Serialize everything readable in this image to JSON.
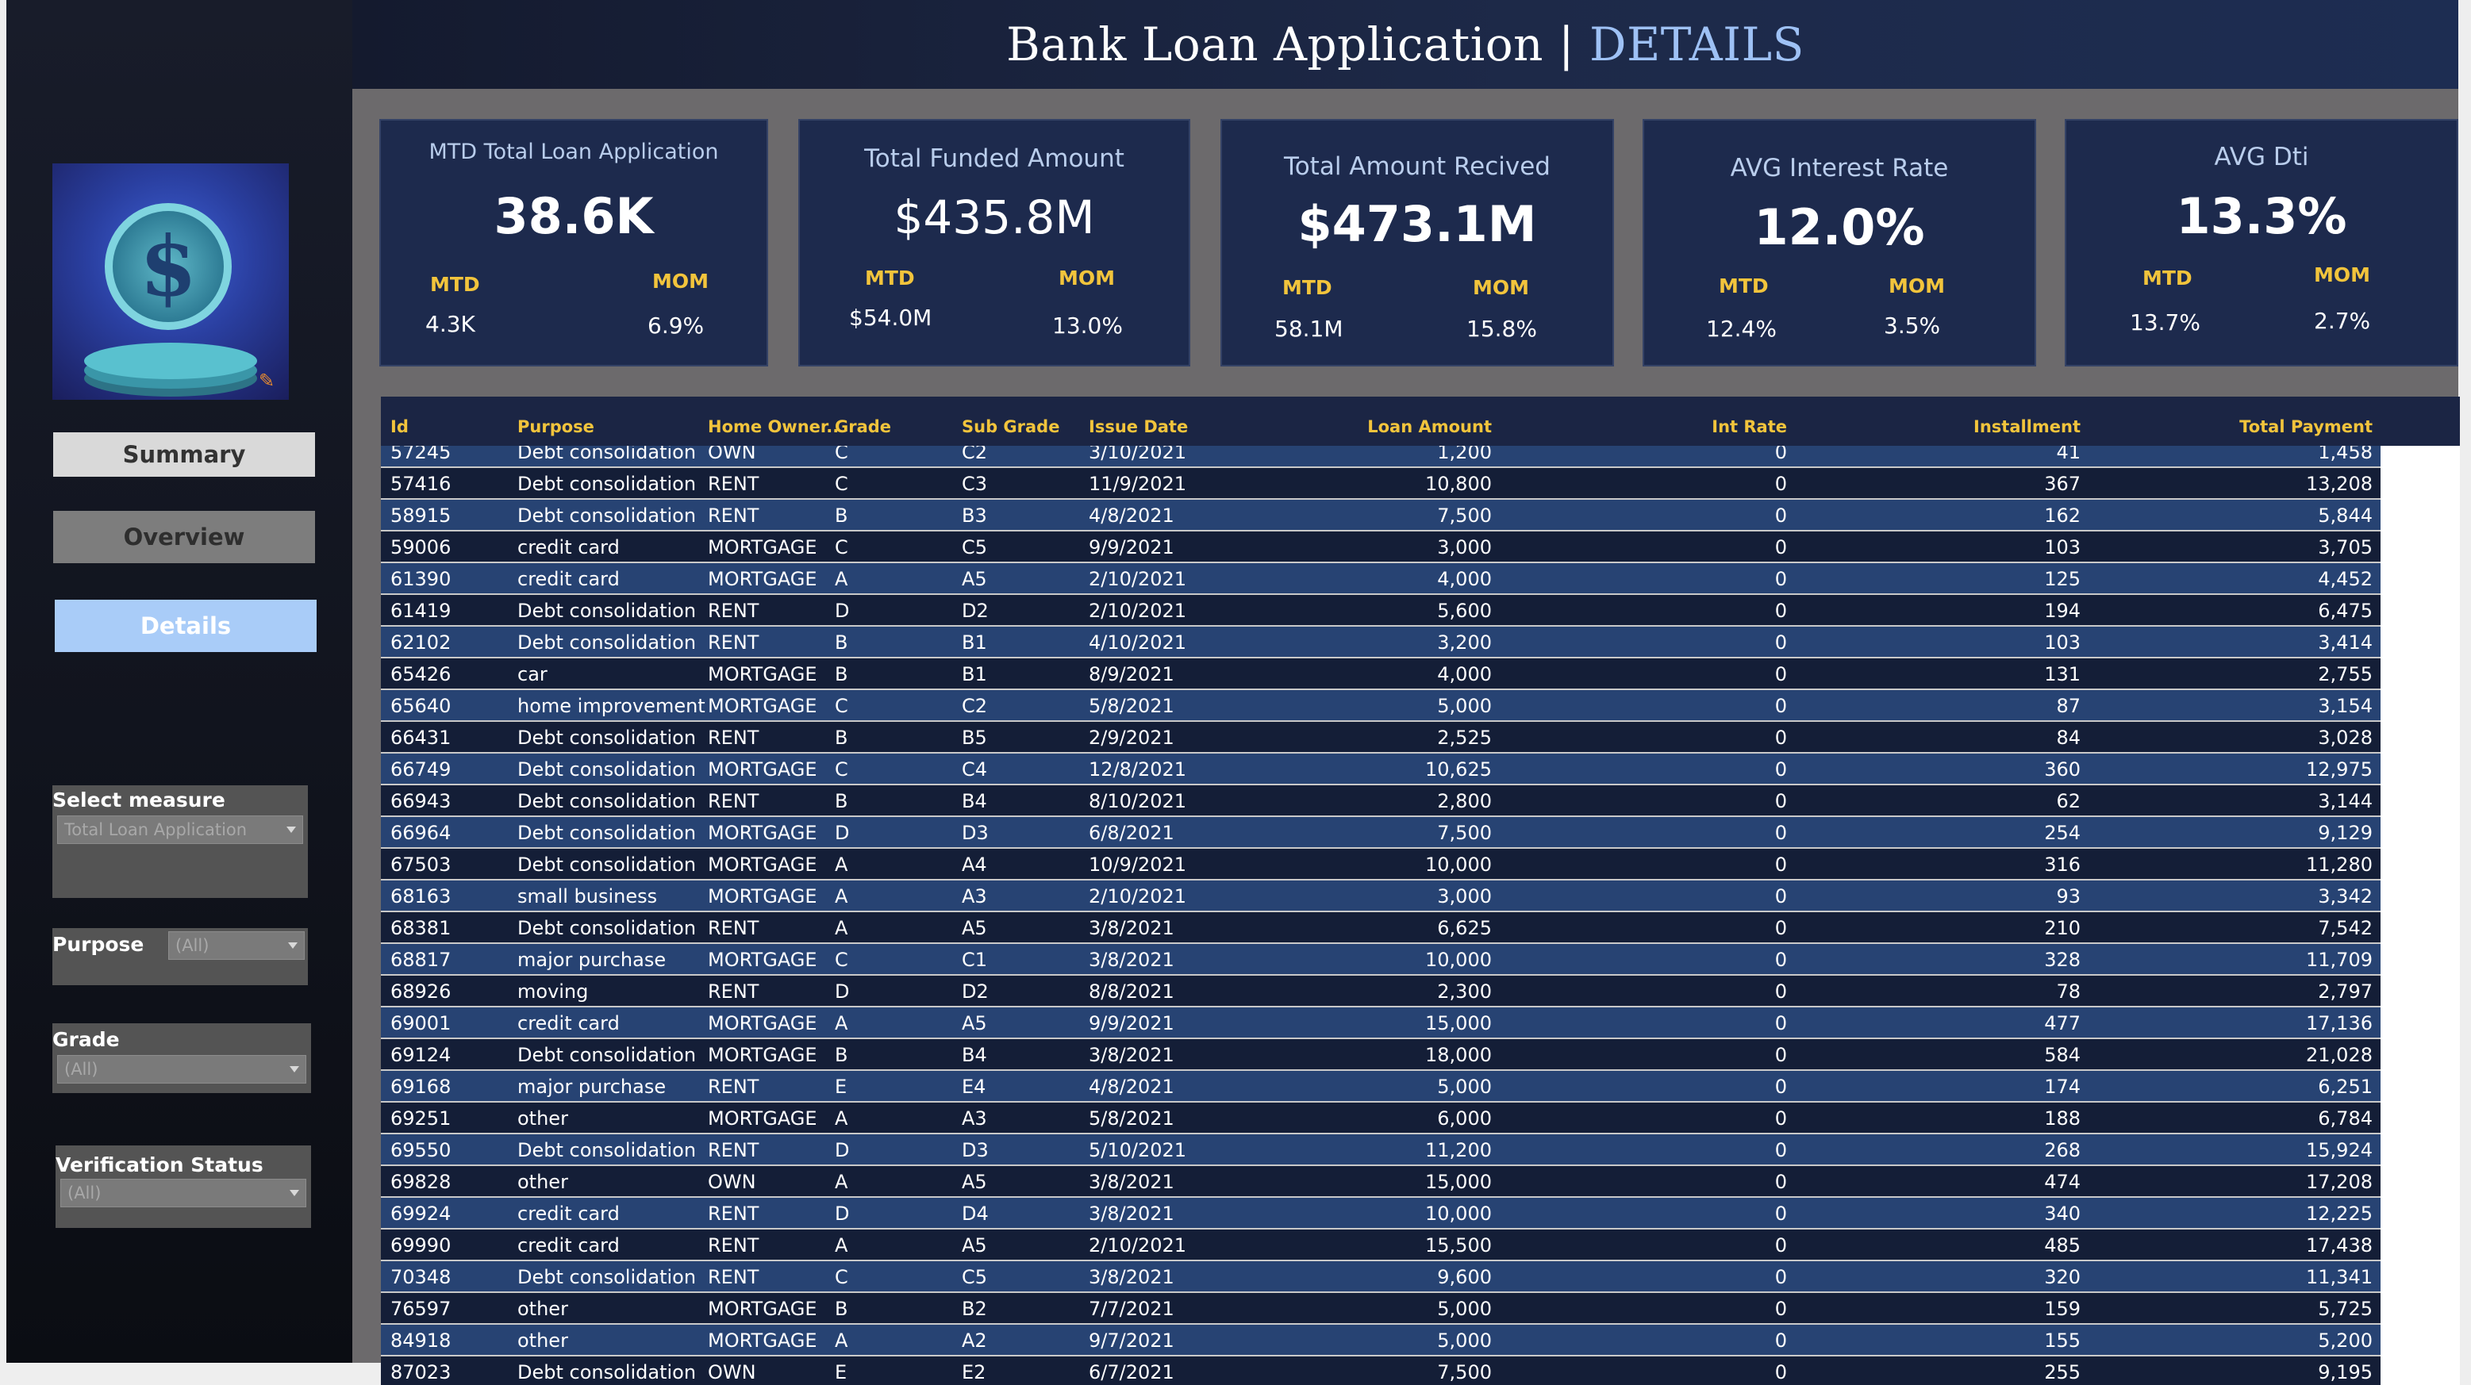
{
  "header": {
    "title_main": "Bank Loan Application | ",
    "title_accent": "DETAILS"
  },
  "sidebar": {
    "logo_icon": "dollar-coin-icon",
    "nav": {
      "summary": "Summary",
      "overview": "Overview",
      "details": "Details"
    },
    "filters": {
      "measure": {
        "label": "Select measure",
        "value": "Total Loan Application"
      },
      "purpose": {
        "label": "Purpose",
        "value": "(All)"
      },
      "grade": {
        "label": "Grade",
        "value": "(All)"
      },
      "verification": {
        "label": "Verification Status",
        "value": "(All)"
      }
    }
  },
  "kpis": [
    {
      "title": "MTD Total Loan Application",
      "value": "38.6K",
      "mtd_label": "MTD",
      "mtd": "4.3K",
      "mom_label": "MOM",
      "mom": "6.9%"
    },
    {
      "title": "Total Funded Amount",
      "value": "$435.8M",
      "mtd_label": "MTD",
      "mtd": "$54.0M",
      "mom_label": "MOM",
      "mom": "13.0%"
    },
    {
      "title": "Total Amount Recived",
      "value": "$473.1M",
      "mtd_label": "MTD",
      "mtd": "58.1M",
      "mom_label": "MOM",
      "mom": "15.8%"
    },
    {
      "title": "AVG Interest Rate",
      "value": "12.0%",
      "mtd_label": "MTD",
      "mtd": "12.4%",
      "mom_label": "MOM",
      "mom": "3.5%"
    },
    {
      "title": "AVG Dti",
      "value": "13.3%",
      "mtd_label": "MTD",
      "mtd": "13.7%",
      "mom_label": "MOM",
      "mom": "2.7%"
    }
  ],
  "table": {
    "headers": [
      "Id",
      "Purpose",
      "Home Owner..",
      "Grade",
      "Sub Grade",
      "Issue Date",
      "Loan Amount",
      "Int Rate",
      "Installment",
      "Total Payment"
    ],
    "rows": [
      [
        "57245",
        "Debt consolidation",
        "OWN",
        "C",
        "C2",
        "3/10/2021",
        "1,200",
        "0",
        "41",
        "1,458"
      ],
      [
        "57416",
        "Debt consolidation",
        "RENT",
        "C",
        "C3",
        "11/9/2021",
        "10,800",
        "0",
        "367",
        "13,208"
      ],
      [
        "58915",
        "Debt consolidation",
        "RENT",
        "B",
        "B3",
        "4/8/2021",
        "7,500",
        "0",
        "162",
        "5,844"
      ],
      [
        "59006",
        "credit card",
        "MORTGAGE",
        "C",
        "C5",
        "9/9/2021",
        "3,000",
        "0",
        "103",
        "3,705"
      ],
      [
        "61390",
        "credit card",
        "MORTGAGE",
        "A",
        "A5",
        "2/10/2021",
        "4,000",
        "0",
        "125",
        "4,452"
      ],
      [
        "61419",
        "Debt consolidation",
        "RENT",
        "D",
        "D2",
        "2/10/2021",
        "5,600",
        "0",
        "194",
        "6,475"
      ],
      [
        "62102",
        "Debt consolidation",
        "RENT",
        "B",
        "B1",
        "4/10/2021",
        "3,200",
        "0",
        "103",
        "3,414"
      ],
      [
        "65426",
        "car",
        "MORTGAGE",
        "B",
        "B1",
        "8/9/2021",
        "4,000",
        "0",
        "131",
        "2,755"
      ],
      [
        "65640",
        "home improvement",
        "MORTGAGE",
        "C",
        "C2",
        "5/8/2021",
        "5,000",
        "0",
        "87",
        "3,154"
      ],
      [
        "66431",
        "Debt consolidation",
        "RENT",
        "B",
        "B5",
        "2/9/2021",
        "2,525",
        "0",
        "84",
        "3,028"
      ],
      [
        "66749",
        "Debt consolidation",
        "MORTGAGE",
        "C",
        "C4",
        "12/8/2021",
        "10,625",
        "0",
        "360",
        "12,975"
      ],
      [
        "66943",
        "Debt consolidation",
        "RENT",
        "B",
        "B4",
        "8/10/2021",
        "2,800",
        "0",
        "62",
        "3,144"
      ],
      [
        "66964",
        "Debt consolidation",
        "MORTGAGE",
        "D",
        "D3",
        "6/8/2021",
        "7,500",
        "0",
        "254",
        "9,129"
      ],
      [
        "67503",
        "Debt consolidation",
        "MORTGAGE",
        "A",
        "A4",
        "10/9/2021",
        "10,000",
        "0",
        "316",
        "11,280"
      ],
      [
        "68163",
        "small business",
        "MORTGAGE",
        "A",
        "A3",
        "2/10/2021",
        "3,000",
        "0",
        "93",
        "3,342"
      ],
      [
        "68381",
        "Debt consolidation",
        "RENT",
        "A",
        "A5",
        "3/8/2021",
        "6,625",
        "0",
        "210",
        "7,542"
      ],
      [
        "68817",
        "major purchase",
        "MORTGAGE",
        "C",
        "C1",
        "3/8/2021",
        "10,000",
        "0",
        "328",
        "11,709"
      ],
      [
        "68926",
        "moving",
        "RENT",
        "D",
        "D2",
        "8/8/2021",
        "2,300",
        "0",
        "78",
        "2,797"
      ],
      [
        "69001",
        "credit card",
        "MORTGAGE",
        "A",
        "A5",
        "9/9/2021",
        "15,000",
        "0",
        "477",
        "17,136"
      ],
      [
        "69124",
        "Debt consolidation",
        "MORTGAGE",
        "B",
        "B4",
        "3/8/2021",
        "18,000",
        "0",
        "584",
        "21,028"
      ],
      [
        "69168",
        "major purchase",
        "RENT",
        "E",
        "E4",
        "4/8/2021",
        "5,000",
        "0",
        "174",
        "6,251"
      ],
      [
        "69251",
        "other",
        "MORTGAGE",
        "A",
        "A3",
        "5/8/2021",
        "6,000",
        "0",
        "188",
        "6,784"
      ],
      [
        "69550",
        "Debt consolidation",
        "RENT",
        "D",
        "D3",
        "5/10/2021",
        "11,200",
        "0",
        "268",
        "15,924"
      ],
      [
        "69828",
        "other",
        "OWN",
        "A",
        "A5",
        "3/8/2021",
        "15,000",
        "0",
        "474",
        "17,208"
      ],
      [
        "69924",
        "credit card",
        "RENT",
        "D",
        "D4",
        "3/8/2021",
        "10,000",
        "0",
        "340",
        "12,225"
      ],
      [
        "69990",
        "credit card",
        "RENT",
        "A",
        "A5",
        "2/10/2021",
        "15,500",
        "0",
        "485",
        "17,438"
      ],
      [
        "70348",
        "Debt consolidation",
        "RENT",
        "C",
        "C5",
        "3/8/2021",
        "9,600",
        "0",
        "320",
        "11,341"
      ],
      [
        "76597",
        "other",
        "MORTGAGE",
        "B",
        "B2",
        "7/7/2021",
        "5,000",
        "0",
        "159",
        "5,725"
      ],
      [
        "84918",
        "other",
        "MORTGAGE",
        "A",
        "A2",
        "9/7/2021",
        "5,000",
        "0",
        "155",
        "5,200"
      ],
      [
        "87023",
        "Debt consolidation",
        "OWN",
        "E",
        "E2",
        "6/7/2021",
        "7,500",
        "0",
        "255",
        "9,195"
      ]
    ]
  }
}
